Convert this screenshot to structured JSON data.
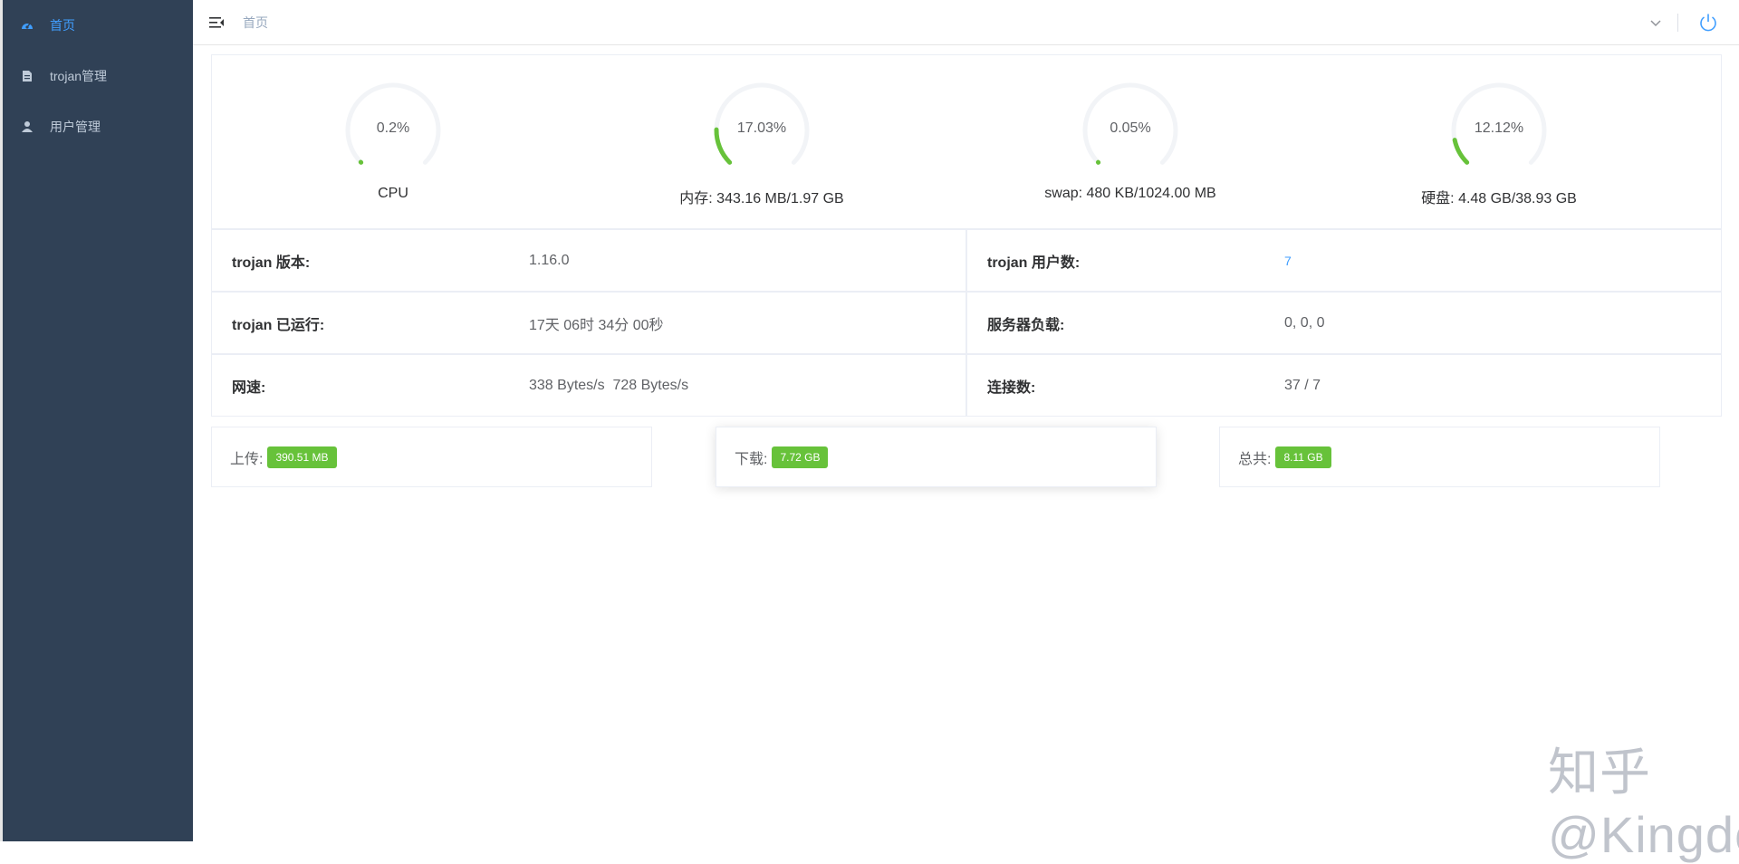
{
  "sidebar": {
    "items": [
      {
        "label": "首页",
        "icon": "dashboard-icon",
        "active": true
      },
      {
        "label": "trojan管理",
        "icon": "document-icon",
        "active": false
      },
      {
        "label": "用户管理",
        "icon": "user-icon",
        "active": false
      }
    ]
  },
  "navbar": {
    "breadcrumb": "首页",
    "icons": [
      "hamburger-icon",
      "chevron-down-icon",
      "power-icon"
    ]
  },
  "gauges": [
    {
      "value": "0.2%",
      "label": "CPU",
      "percent": 0.2
    },
    {
      "value": "17.03%",
      "label": "内存: 343.16 MB/1.97 GB",
      "percent": 17.03
    },
    {
      "value": "0.05%",
      "label": "swap: 480 KB/1024.00 MB",
      "percent": 0.05
    },
    {
      "value": "12.12%",
      "label": "硬盘: 4.48 GB/38.93 GB",
      "percent": 12.12
    }
  ],
  "info": {
    "version_key": "trojan 版本:",
    "version_val": "1.16.0",
    "users_key": "trojan 用户数:",
    "users_val": "7",
    "uptime_key": "trojan 已运行:",
    "uptime_val": "17天 06时 34分 00秒",
    "load_key": "服务器负载:",
    "load_val": "0, 0, 0",
    "speed_key": "网速:",
    "speed_val": "338 Bytes/s  728 Bytes/s",
    "conn_key": "连接数:",
    "conn_val": "37 / 7"
  },
  "traffic": {
    "upload_label": "上传:",
    "upload_val": "390.51 MB",
    "download_label": "下载:",
    "download_val": "7.72 GB",
    "total_label": "总共:",
    "total_val": "8.11 GB"
  },
  "colors": {
    "sidebar_bg": "#304156",
    "accent": "#409eff",
    "gauge": "#67c23a",
    "tag": "#67c23a"
  },
  "watermark": "知乎 @Kingdo"
}
